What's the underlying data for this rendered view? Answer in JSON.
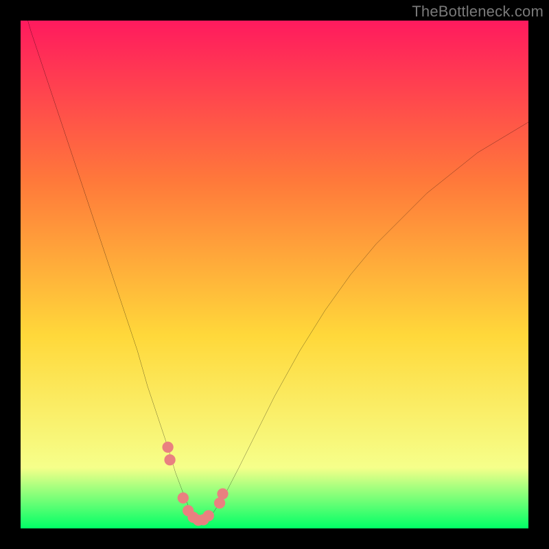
{
  "watermark": "TheBottleneck.com",
  "chart_data": {
    "type": "line",
    "title": "",
    "xlabel": "",
    "ylabel": "",
    "xlim": [
      0,
      100
    ],
    "ylim": [
      0,
      100
    ],
    "background_gradient": [
      "#ff1a5e",
      "#ff7a3a",
      "#ffd83a",
      "#f6ff8a",
      "#00ff66"
    ],
    "series": [
      {
        "name": "curve",
        "x": [
          0,
          2,
          5,
          8,
          11,
          14,
          17,
          20,
          23,
          25,
          27,
          29,
          30.5,
          32,
          33,
          34,
          34.8,
          35.5,
          36.5,
          38,
          40,
          43,
          46,
          50,
          55,
          60,
          65,
          70,
          75,
          80,
          85,
          90,
          95,
          100
        ],
        "y": [
          105,
          98,
          89,
          80,
          71,
          62,
          53,
          44,
          35,
          28,
          22,
          16,
          11,
          7,
          4.5,
          2.8,
          1.6,
          1.2,
          1.6,
          3.2,
          6.2,
          12,
          18,
          26,
          35,
          43,
          50,
          56,
          61,
          66,
          70,
          74,
          77,
          80
        ]
      }
    ],
    "markers": {
      "name": "highlight-points",
      "color": "#e98080",
      "radius": 1.1,
      "x": [
        29.0,
        29.4,
        32.0,
        33.0,
        34.0,
        35.0,
        36.0,
        37.0,
        39.2,
        39.8
      ],
      "y": [
        16.0,
        13.5,
        6.0,
        3.5,
        2.2,
        1.6,
        1.7,
        2.5,
        5.0,
        6.8
      ]
    }
  }
}
